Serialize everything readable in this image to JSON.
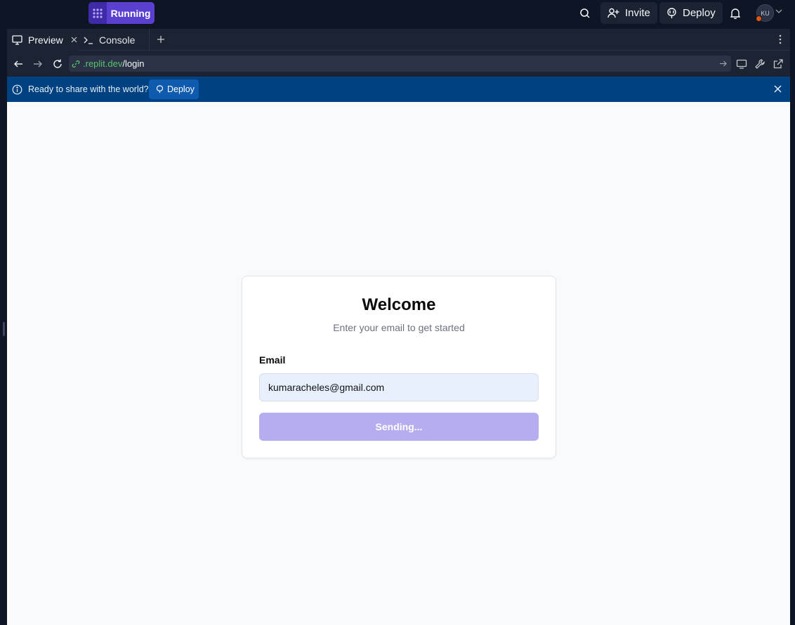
{
  "topbar": {
    "run_label": "Running",
    "invite_label": "Invite",
    "deploy_label": "Deploy",
    "avatar_initials": "KU"
  },
  "tabs": [
    {
      "label": "Preview",
      "icon": "monitor-icon",
      "active": true
    },
    {
      "label": "Console",
      "icon": "terminal-icon",
      "active": false
    }
  ],
  "urlbar": {
    "host": ".replit.dev",
    "path": "/login"
  },
  "banner": {
    "text": "Ready to share with the world?",
    "deploy_label": "Deploy"
  },
  "login": {
    "title": "Welcome",
    "subtitle": "Enter your email to get started",
    "email_label": "Email",
    "email_value": "kumaracheles@gmail.com",
    "submit_label": "Sending..."
  },
  "colors": {
    "accent": "#5b3fd1",
    "banner": "#004182",
    "button_disabled": "#b4aef0",
    "url_host": "#58c46f"
  }
}
